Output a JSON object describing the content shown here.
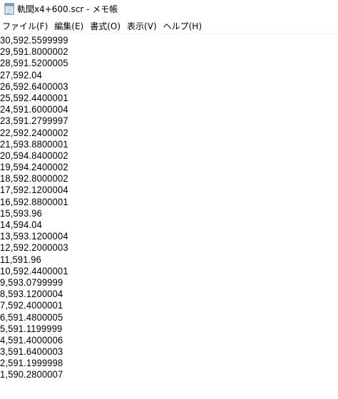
{
  "window": {
    "title": "軌間x4+600.scr - メモ帳",
    "icon": "notepad-icon"
  },
  "menu": [
    {
      "label": "ファイル(F)",
      "name": "menu-file"
    },
    {
      "label": "編集(E)",
      "name": "menu-edit"
    },
    {
      "label": "書式(O)",
      "name": "menu-format"
    },
    {
      "label": "表示(V)",
      "name": "menu-view"
    },
    {
      "label": "ヘルプ(H)",
      "name": "menu-help"
    }
  ],
  "editor": {
    "lines": [
      "30,592.5599999",
      "29,591.8000002",
      "28,591.5200005",
      "27,592.04",
      "26,592.6400003",
      "25,592.4400001",
      "24,591.6000004",
      "23,591.2799997",
      "22,592.2400002",
      "21,593.8800001",
      "20,594.8400002",
      "19,594.2400002",
      "18,592.8000002",
      "17,592.1200004",
      "16,592.8800001",
      "15,593.96",
      "14,594.04",
      "13,593.1200004",
      "12,592.2000003",
      "11,591.96",
      "10,592.4400001",
      "9,593.0799999",
      "8,593.1200004",
      "7,592.4000001",
      "6,591.4800005",
      "5,591.1199999",
      "4,591.4000006",
      "3,591.6400003",
      "2,591.1999998",
      "1,590.2800007"
    ]
  }
}
